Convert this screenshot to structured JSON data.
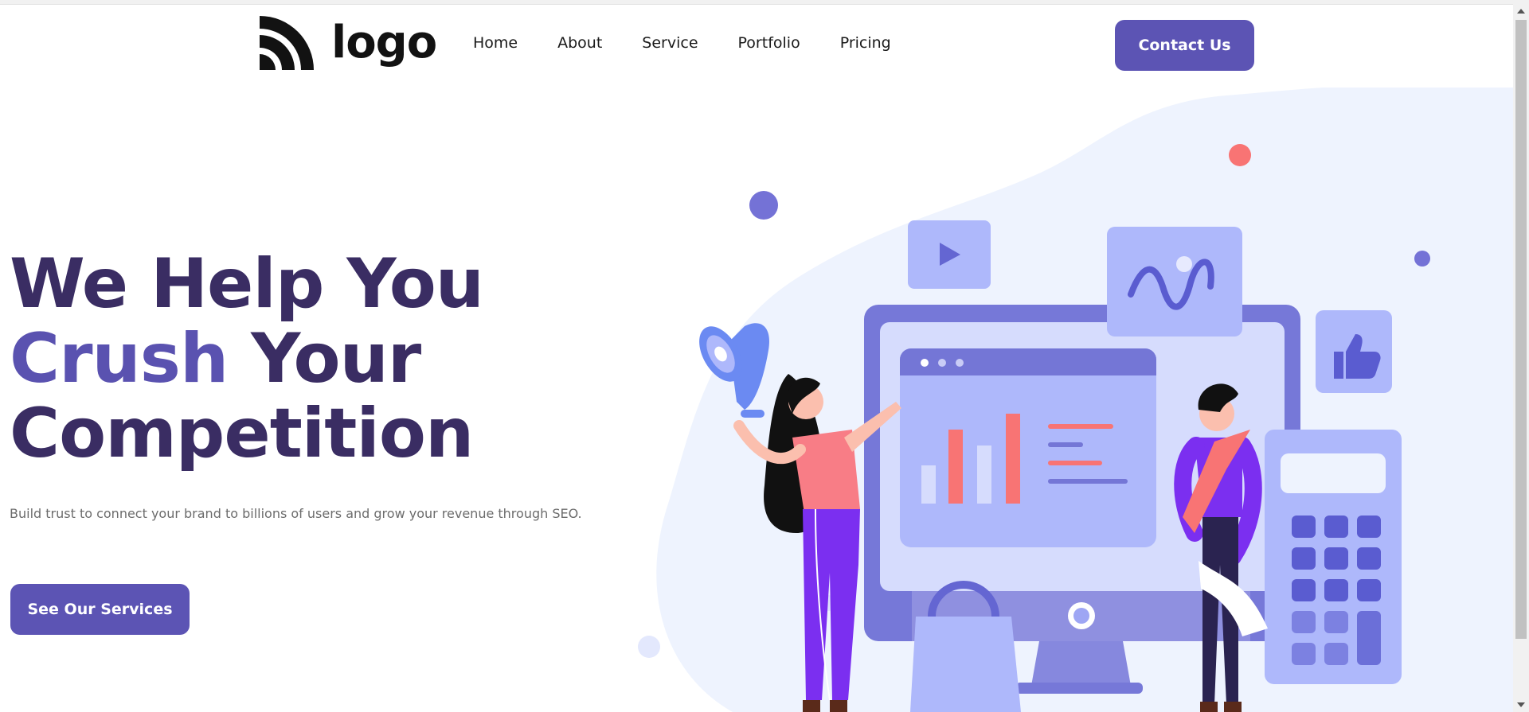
{
  "header": {
    "logo_text": "logo",
    "nav": [
      "Home",
      "About",
      "Service",
      "Portfolio",
      "Pricing"
    ],
    "contact_label": "Contact Us"
  },
  "hero": {
    "title_line1": "We Help You",
    "title_accent": "Crush",
    "title_line2_rest": " Your",
    "title_line3": "Competition",
    "subtitle": "Build trust to connect your brand to billions of users and grow your revenue through SEO.",
    "cta_label": "See Our Services"
  },
  "colors": {
    "primary": "#5c54b4",
    "title": "#3a2d63",
    "accent": "#5a52b0",
    "blob": "#eef3fe",
    "coral": "#f87474"
  }
}
